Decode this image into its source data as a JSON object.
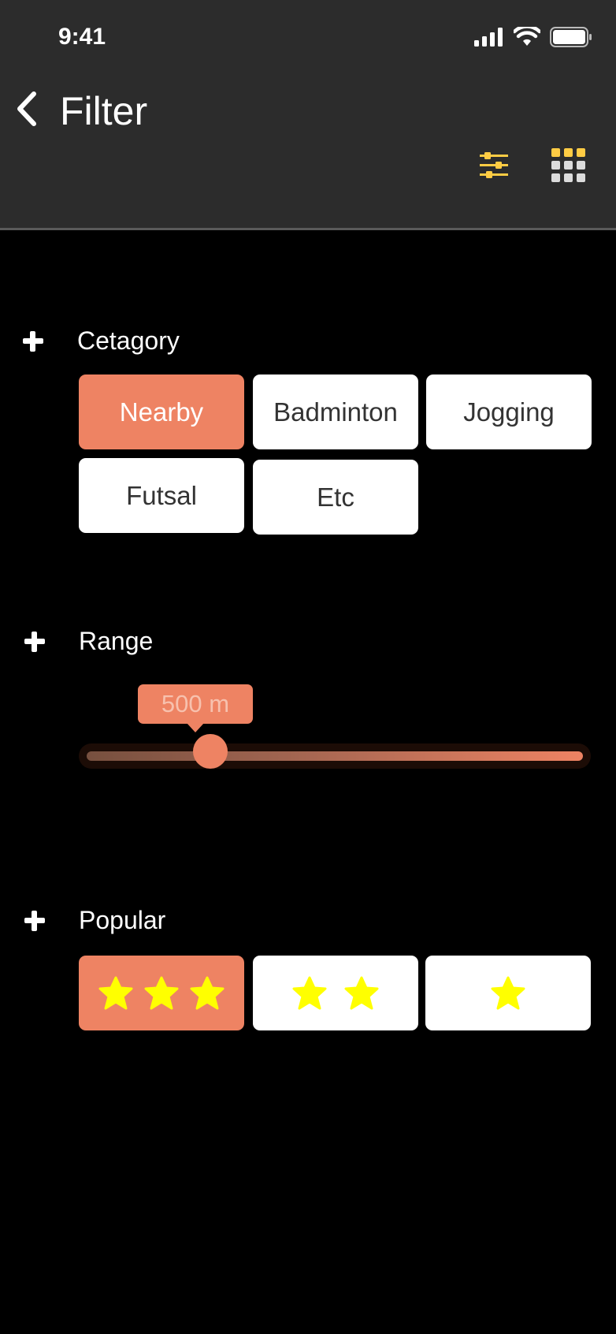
{
  "status": {
    "time": "9:41"
  },
  "header": {
    "title": "Filter"
  },
  "sections": {
    "category": {
      "title": "Cetagory",
      "chips": [
        "Nearby",
        "Badminton",
        "Jogging",
        "Futsal",
        "Etc"
      ],
      "selected": "Nearby"
    },
    "range": {
      "title": "Range",
      "value_label": "500 m",
      "value_fraction": 0.22
    },
    "popular": {
      "title": "Popular",
      "options": [
        {
          "stars": 3,
          "selected": true
        },
        {
          "stars": 2,
          "selected": false
        },
        {
          "stars": 1,
          "selected": false
        }
      ]
    }
  },
  "colors": {
    "accent": "#ee8363",
    "star": "#ffff00",
    "toolbar_icon_active": "#ffcc44",
    "header_bg": "#2c2c2c"
  },
  "icons": [
    "back-chevron-icon",
    "filter-sliders-icon",
    "grid-icon",
    "plus-icon",
    "star-icon"
  ]
}
